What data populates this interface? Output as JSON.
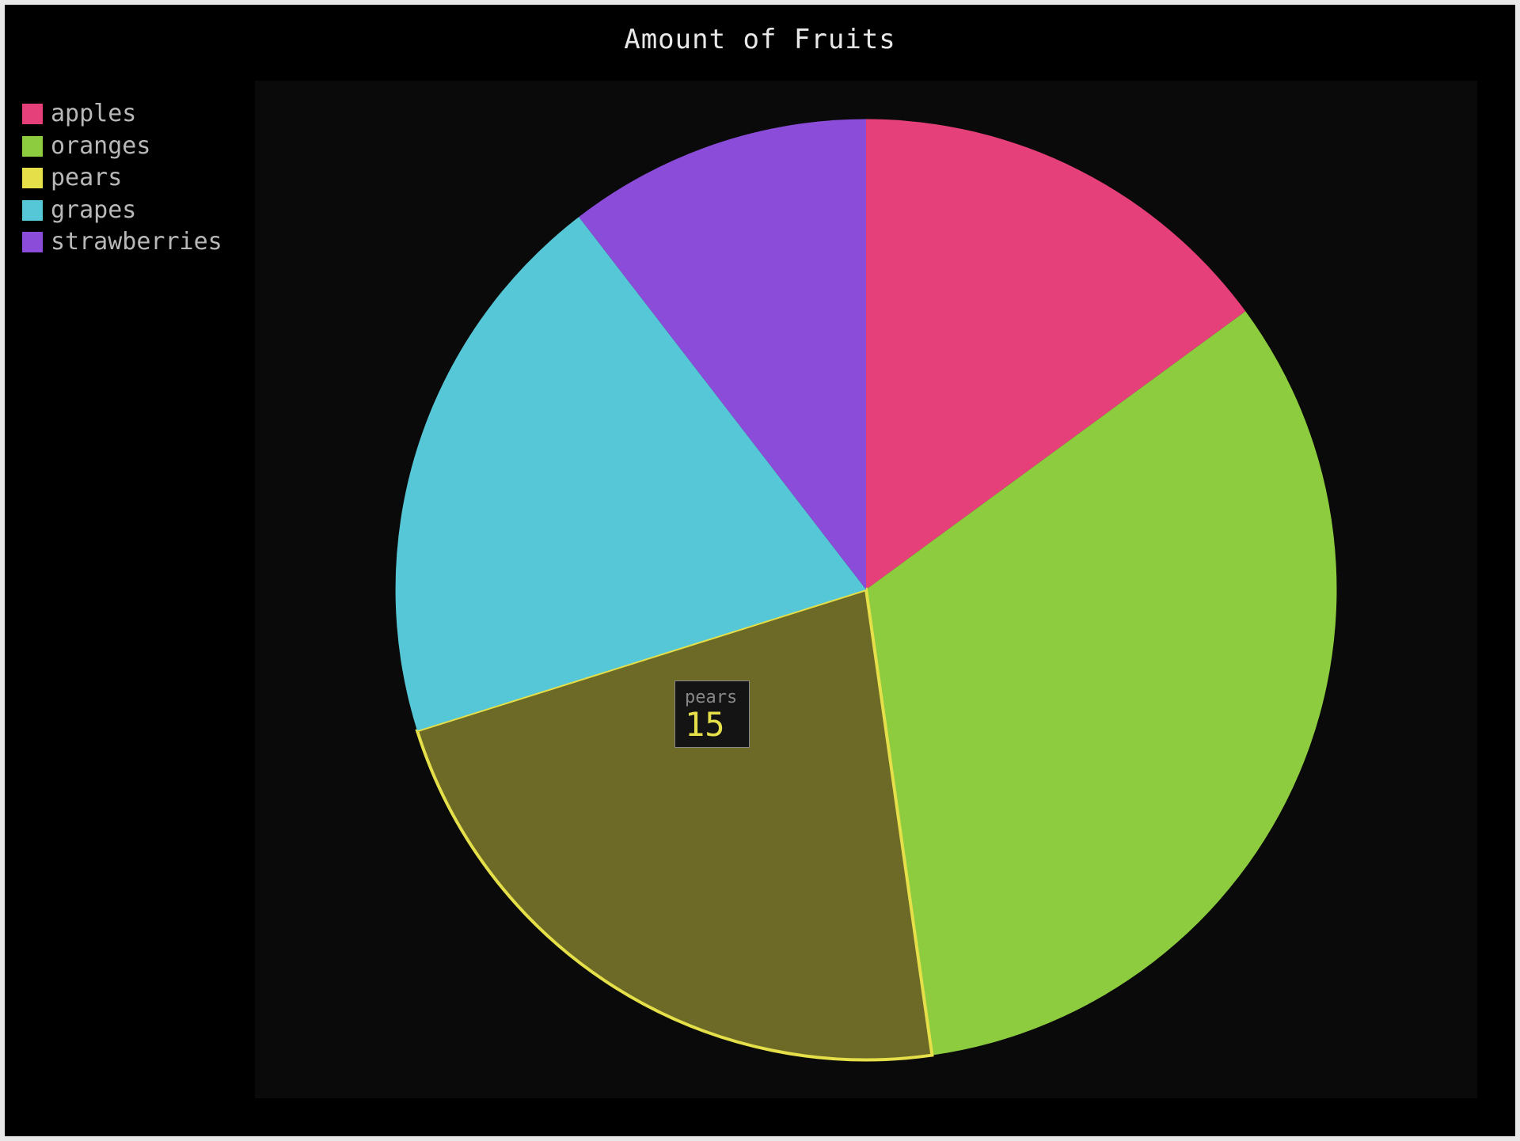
{
  "chart_data": {
    "type": "pie",
    "title": "Amount of Fruits",
    "series": [
      {
        "name": "apples",
        "value": 10,
        "color": "#e6407a"
      },
      {
        "name": "oranges",
        "value": 22,
        "color": "#8ecc3f"
      },
      {
        "name": "pears",
        "value": 15,
        "color": "#e5e04a"
      },
      {
        "name": "grapes",
        "value": 13,
        "color": "#56c7d6"
      },
      {
        "name": "strawberries",
        "value": 7,
        "color": "#8a4cd9"
      }
    ],
    "legend_position": "top-left",
    "highlighted_index": 2
  },
  "tooltip": {
    "label": "pears",
    "value": "15",
    "color": "#e5e04a"
  }
}
